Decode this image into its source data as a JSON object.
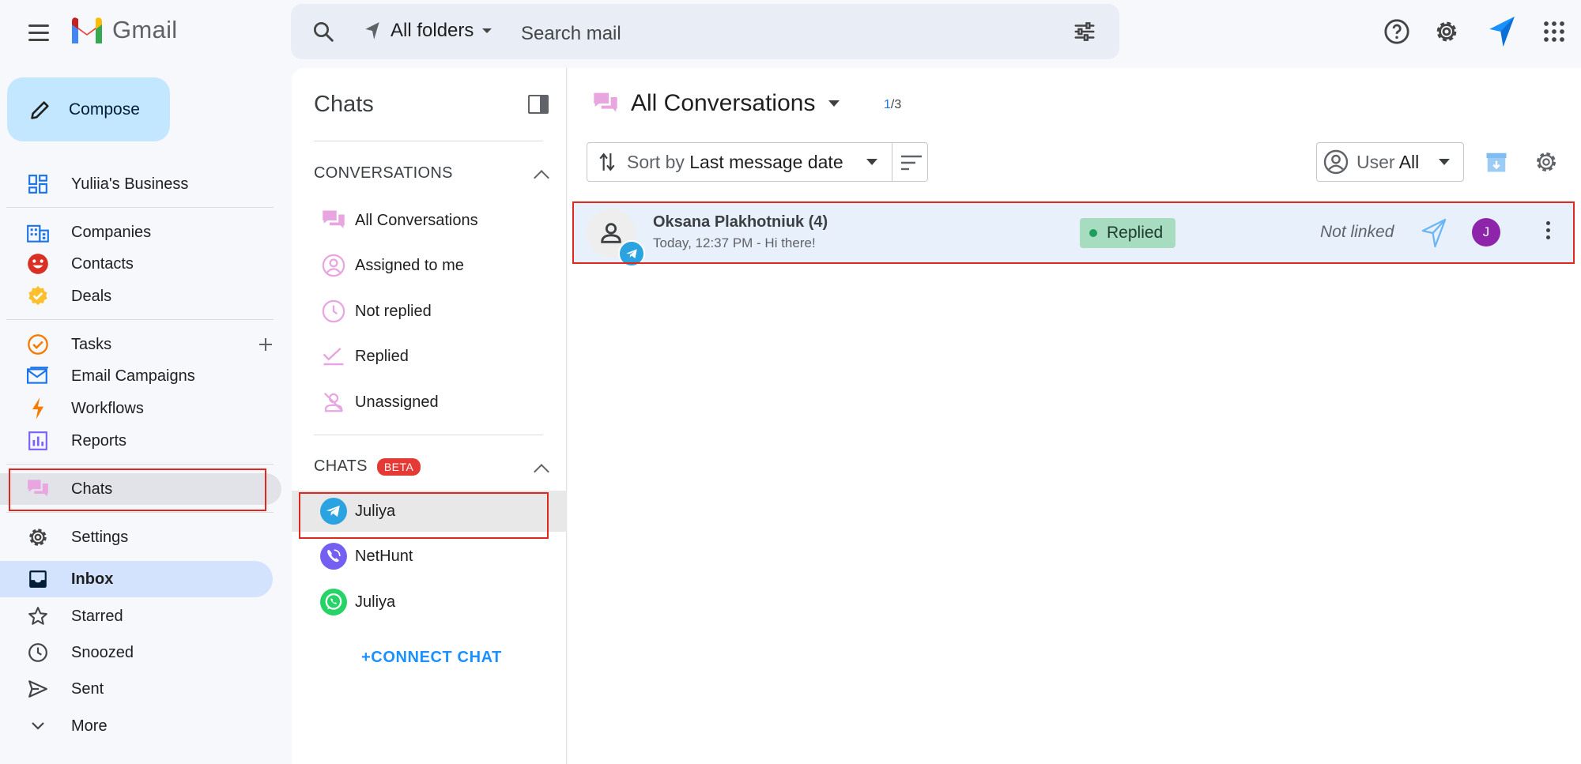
{
  "app": {
    "name": "Gmail"
  },
  "search": {
    "folders_label": "All folders",
    "placeholder": "Search mail"
  },
  "compose": {
    "label": "Compose"
  },
  "nav": {
    "business": "Yuliia's Business",
    "companies": "Companies",
    "contacts": "Contacts",
    "deals": "Deals",
    "tasks": "Tasks",
    "email_campaigns": "Email Campaigns",
    "workflows": "Workflows",
    "reports": "Reports",
    "chats": "Chats",
    "settings": "Settings",
    "inbox": "Inbox",
    "starred": "Starred",
    "snoozed": "Snoozed",
    "sent": "Sent",
    "more": "More"
  },
  "chats_panel": {
    "title": "Chats",
    "conversations_header": "CONVERSATIONS",
    "conversations": [
      "All Conversations",
      "Assigned to me",
      "Not replied",
      "Replied",
      "Unassigned"
    ],
    "chats_header": "CHATS",
    "beta_badge": "BETA",
    "chats": [
      {
        "name": "Juliya",
        "channel": "telegram"
      },
      {
        "name": "NetHunt",
        "channel": "viber"
      },
      {
        "name": "Juliya",
        "channel": "whatsapp"
      }
    ],
    "connect_label": "+CONNECT CHAT"
  },
  "main": {
    "title": "All Conversations",
    "count_current": "1",
    "count_total": "/3",
    "sort_prefix": "Sort by",
    "sort_value": "Last message date",
    "user_prefix": "User",
    "user_value": "All",
    "conversation": {
      "name": "Oksana Plakhotniuk (4)",
      "subtitle": "Today, 12:37 PM - Hi there!",
      "status": "Replied",
      "link_status": "Not linked",
      "assignee_initial": "J"
    }
  },
  "colors": {
    "accent_blue": "#1a73e8",
    "highlight_red": "#e0281e",
    "telegram": "#2aa3e0",
    "status_green": "#a8dcc0"
  }
}
